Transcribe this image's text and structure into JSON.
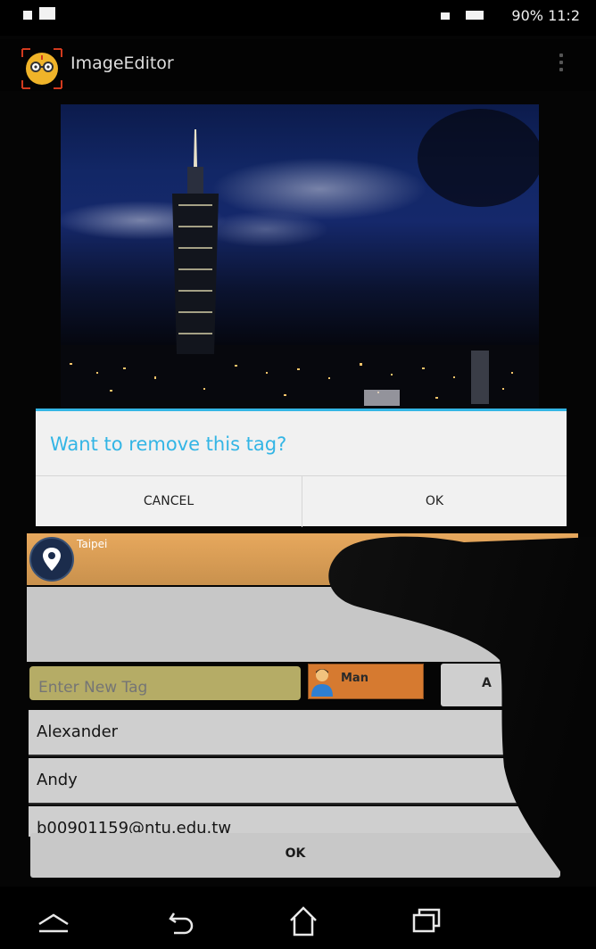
{
  "app": {
    "title": "ImageEditor"
  },
  "status_bar": {
    "text": "90%  11:2"
  },
  "photo": {
    "subject": "Taipei 101 at night"
  },
  "tag_location": {
    "label": "Taipei"
  },
  "tag_entry": {
    "placeholder": "Enter New Tag",
    "type_button": "Man",
    "add_button": "A"
  },
  "tag_list": [
    {
      "name": "Alexander"
    },
    {
      "name": "Andy"
    },
    {
      "name": "b00901159@ntu.edu.tw"
    }
  ],
  "bottom_button": {
    "label": "OK"
  },
  "dialog": {
    "title": "Want to remove this tag?",
    "cancel_label": "CANCEL",
    "ok_label": "OK"
  },
  "navigation": {
    "buttons": [
      "up-icon",
      "back-icon",
      "home-icon",
      "recent-apps-icon"
    ]
  },
  "colors": {
    "accent": "#33b5e5",
    "location_bar": "#d9994f",
    "type_button": "#d67a30",
    "input_bg": "#b5ac66"
  }
}
